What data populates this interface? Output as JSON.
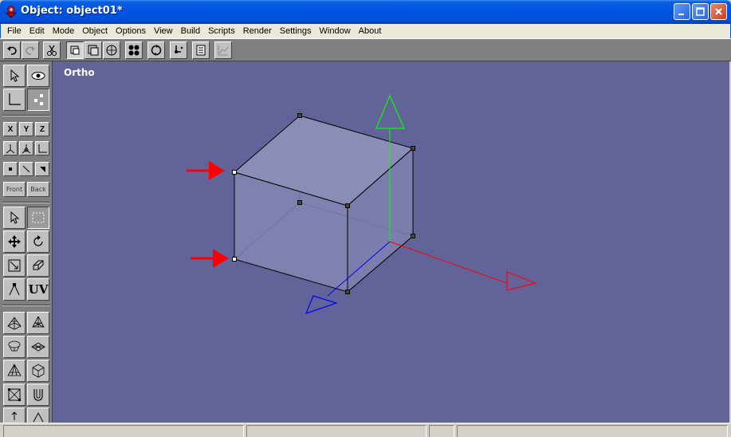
{
  "window": {
    "title": "Object: object01*"
  },
  "menu": {
    "items": [
      "File",
      "Edit",
      "Mode",
      "Object",
      "Options",
      "View",
      "Build",
      "Scripts",
      "Render",
      "Settings",
      "Window",
      "About"
    ]
  },
  "toolbar": {
    "buttons": [
      {
        "name": "undo-button",
        "icon": "undo-icon"
      },
      {
        "name": "redo-button",
        "icon": "redo-icon",
        "state": "disabled"
      },
      {
        "name": "cut-button",
        "icon": "scissors-icon"
      },
      {
        "name": "vertex-mode-button",
        "icon": "vertex-mode-icon",
        "state": "pressed"
      },
      {
        "name": "face-mode-button",
        "icon": "face-mode-icon"
      },
      {
        "name": "object-mode-button",
        "icon": "object-mode-icon"
      },
      {
        "name": "quad-view-button",
        "icon": "quad-view-icon"
      },
      {
        "name": "orbit-button",
        "icon": "orbit-icon"
      },
      {
        "name": "snap-button",
        "icon": "snap-icon"
      },
      {
        "name": "list-button",
        "icon": "list-icon"
      },
      {
        "name": "graph-button",
        "icon": "graph-icon",
        "state": "disabled"
      }
    ]
  },
  "palette": {
    "axis_labels": [
      "X",
      "Y",
      "Z"
    ],
    "front_label": "Front",
    "back_label": "Back",
    "uv_label": "UV"
  },
  "viewport": {
    "label": "Ortho",
    "colors": {
      "background": "#626499",
      "cube_fill": "#8d8fb8",
      "edge": "#000000",
      "x_axis": "#ff0000",
      "y_axis": "#00ff00",
      "z_axis": "#0000ff",
      "annotation_arrow": "#ff0000"
    },
    "cube_vertices_3d": [
      [
        -1,
        -1,
        -1
      ],
      [
        1,
        -1,
        -1
      ],
      [
        1,
        1,
        -1
      ],
      [
        -1,
        1,
        -1
      ],
      [
        -1,
        -1,
        1
      ],
      [
        1,
        -1,
        1
      ],
      [
        1,
        1,
        1
      ],
      [
        -1,
        1,
        1
      ]
    ],
    "cube_edges": [
      [
        0,
        1
      ],
      [
        1,
        2
      ],
      [
        2,
        3
      ],
      [
        3,
        0
      ],
      [
        4,
        5
      ],
      [
        5,
        6
      ],
      [
        6,
        7
      ],
      [
        7,
        4
      ],
      [
        0,
        4
      ],
      [
        1,
        5
      ],
      [
        2,
        6
      ],
      [
        3,
        7
      ]
    ],
    "selected_vertices": [
      3,
      0
    ]
  },
  "statusbar": {
    "panes": [
      "",
      "",
      "",
      ""
    ]
  }
}
